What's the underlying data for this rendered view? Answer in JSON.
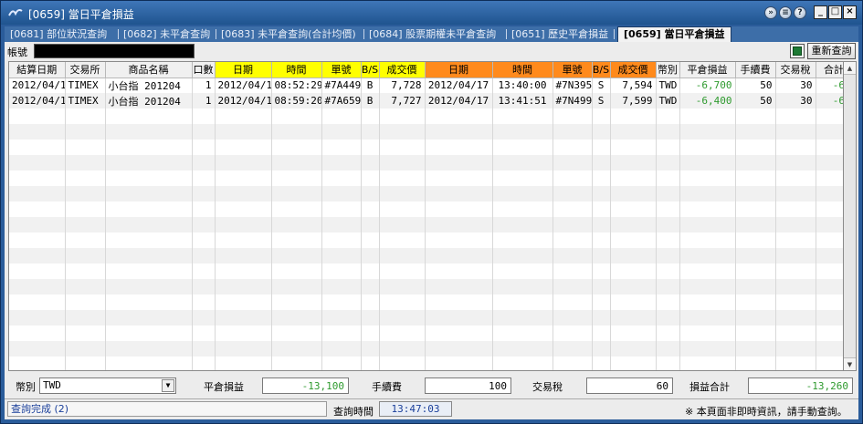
{
  "window": {
    "title": "[0659] 當日平倉損益",
    "controls": [
      "settings-icon",
      "info-icon",
      "help-icon",
      "minimize-icon",
      "maximize-icon",
      "close-icon"
    ]
  },
  "tabs": [
    {
      "label": "[0681] 部位狀況查詢",
      "active": false
    },
    {
      "label": "[0682] 未平倉查詢",
      "active": false
    },
    {
      "label": "[0683] 未平倉查詢(合計均價)",
      "active": false
    },
    {
      "label": "[0684] 股票期權未平倉查詢",
      "active": false
    },
    {
      "label": "[0651] 歷史平倉損益",
      "active": false
    },
    {
      "label": "[0659] 當日平倉損益",
      "active": true
    }
  ],
  "account": {
    "label": "帳號",
    "value": ""
  },
  "toolbar": {
    "refresh_label": "重新查詢",
    "export_icon": "excel-icon"
  },
  "grid": {
    "headers": [
      "結算日期",
      "交易所",
      "商品名稱",
      "口數",
      "日期",
      "時間",
      "單號",
      "B/S",
      "成交價",
      "日期",
      "時間",
      "單號",
      "B/S",
      "成交價",
      "幣別",
      "平倉損益",
      "手續費",
      "交易稅",
      "合計損益"
    ],
    "rows": [
      [
        "2012/04/17",
        "TIMEX",
        "小台指 201204",
        "1",
        "2012/04/17",
        "08:52:29",
        "#7A449",
        "B",
        "7,728",
        "2012/04/17",
        "13:40:00",
        "#7N395",
        "S",
        "7,594",
        "TWD",
        "-6,700",
        "50",
        "30",
        "-6,780"
      ],
      [
        "2012/04/17",
        "TIMEX",
        "小台指 201204",
        "1",
        "2012/04/17",
        "08:59:20",
        "#7A659",
        "B",
        "7,727",
        "2012/04/17",
        "13:41:51",
        "#7N499",
        "S",
        "7,599",
        "TWD",
        "-6,400",
        "50",
        "30",
        "-6,480"
      ]
    ]
  },
  "summary": {
    "currency_label": "幣別",
    "currency_value": "TWD",
    "pnl_label": "平倉損益",
    "pnl_value": "-13,100",
    "fee_label": "手續費",
    "fee_value": "100",
    "tax_label": "交易稅",
    "tax_value": "60",
    "total_label": "損益合計",
    "total_value": "-13,260"
  },
  "status": {
    "message": "查詢完成 (2)",
    "query_time_label": "查詢時間",
    "query_time_value": "13:47:03",
    "notice": "※ 本頁面非即時資訊，請手動查詢。"
  },
  "colors": {
    "open_header": "#ffff00",
    "close_header": "#ff8a1c",
    "negative": "#2e9a2e"
  }
}
